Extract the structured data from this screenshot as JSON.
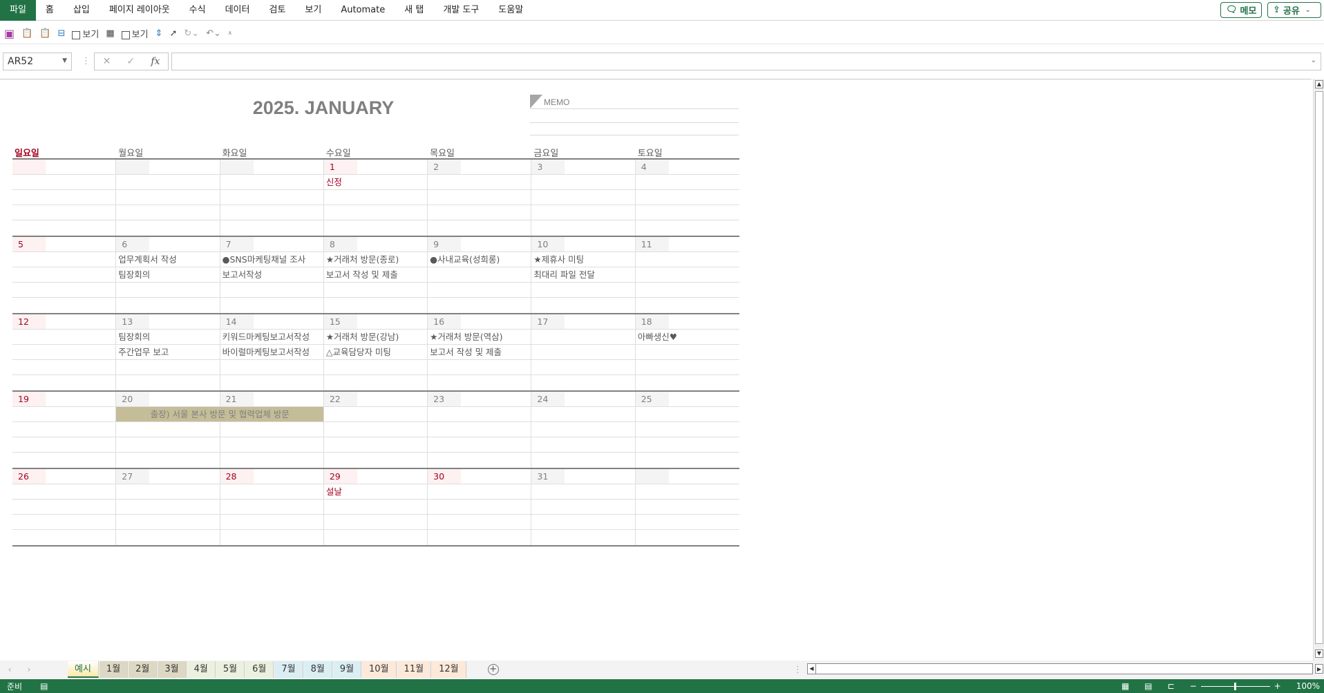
{
  "menu": [
    "파일",
    "홈",
    "삽입",
    "페이지 레이아웃",
    "수식",
    "데이터",
    "검토",
    "보기",
    "Automate",
    "새 탭",
    "개발 도구",
    "도움말"
  ],
  "top_buttons": {
    "memo": "메모",
    "share": "공유"
  },
  "qat": {
    "view1": "보기",
    "view2": "보기"
  },
  "formula_bar": {
    "name_box": "AR52",
    "cancel": "✕",
    "enter": "✓",
    "fx": "fx",
    "value": ""
  },
  "sheet": {
    "title": "2025. JANUARY",
    "memo_label": "MEMO",
    "weekdays": [
      "일요일",
      "월요일",
      "화요일",
      "수요일",
      "목요일",
      "금요일",
      "토요일"
    ],
    "weeks": [
      {
        "days": [
          {
            "n": "",
            "red": true
          },
          {
            "n": ""
          },
          {
            "n": ""
          },
          {
            "n": "1",
            "red": true,
            "events": [
              "신정"
            ],
            "evred": true
          },
          {
            "n": "2"
          },
          {
            "n": "3"
          },
          {
            "n": "4"
          }
        ]
      },
      {
        "days": [
          {
            "n": "5",
            "red": true
          },
          {
            "n": "6",
            "events": [
              "업무계획서 작성",
              "팀장회의"
            ]
          },
          {
            "n": "7",
            "events": [
              "●SNS마케팅채널 조사",
              "보고서작성"
            ]
          },
          {
            "n": "8",
            "events": [
              "★거래처 방문(종로)",
              "보고서 작성 및 제출"
            ]
          },
          {
            "n": "9",
            "events": [
              "●사내교육(성희롱)"
            ]
          },
          {
            "n": "10",
            "events": [
              "★제휴사 미팅",
              "최대리 파일 전달"
            ]
          },
          {
            "n": "11"
          }
        ]
      },
      {
        "days": [
          {
            "n": "12",
            "red": true
          },
          {
            "n": "13",
            "events": [
              "팀장회의",
              "주간업무 보고"
            ]
          },
          {
            "n": "14",
            "events": [
              "키워드마케팅보고서작성",
              "바이럴마케팅보고서작성"
            ]
          },
          {
            "n": "15",
            "events": [
              "★거래처 방문(강남)",
              "△교육담당자 미팅"
            ]
          },
          {
            "n": "16",
            "events": [
              "★거래처 방문(역삼)",
              "보고서 작성 및 제출"
            ]
          },
          {
            "n": "17"
          },
          {
            "n": "18",
            "events": [
              "아빠생신♥"
            ]
          }
        ]
      },
      {
        "days": [
          {
            "n": "19",
            "red": true
          },
          {
            "n": "20"
          },
          {
            "n": "21"
          },
          {
            "n": "22"
          },
          {
            "n": "23"
          },
          {
            "n": "24"
          },
          {
            "n": "25"
          }
        ],
        "band": "출장) 서울 본사 방문 및 협력업체 방문"
      },
      {
        "days": [
          {
            "n": "26",
            "red": true
          },
          {
            "n": "27"
          },
          {
            "n": "28",
            "red": true
          },
          {
            "n": "29",
            "red": true,
            "events": [
              "설날"
            ],
            "evred": true
          },
          {
            "n": "30",
            "red": true
          },
          {
            "n": "31"
          },
          {
            "n": ""
          }
        ]
      }
    ]
  },
  "sheet_tabs": [
    {
      "label": "예시",
      "color": "#fbe9a8",
      "active": true
    },
    {
      "label": "1월",
      "color": "#ddd8c4"
    },
    {
      "label": "2월",
      "color": "#ddd8c4"
    },
    {
      "label": "3월",
      "color": "#ddd8c4"
    },
    {
      "label": "4월",
      "color": "#ebf1de"
    },
    {
      "label": "5월",
      "color": "#ebf1de"
    },
    {
      "label": "6월",
      "color": "#ebf1de"
    },
    {
      "label": "7월",
      "color": "#daeef3"
    },
    {
      "label": "8월",
      "color": "#daeef3"
    },
    {
      "label": "9월",
      "color": "#daeef3"
    },
    {
      "label": "10월",
      "color": "#fde9d9"
    },
    {
      "label": "11월",
      "color": "#fde9d9"
    },
    {
      "label": "12월",
      "color": "#fde9d9"
    }
  ],
  "status": {
    "ready": "준비",
    "zoom": "100%"
  }
}
